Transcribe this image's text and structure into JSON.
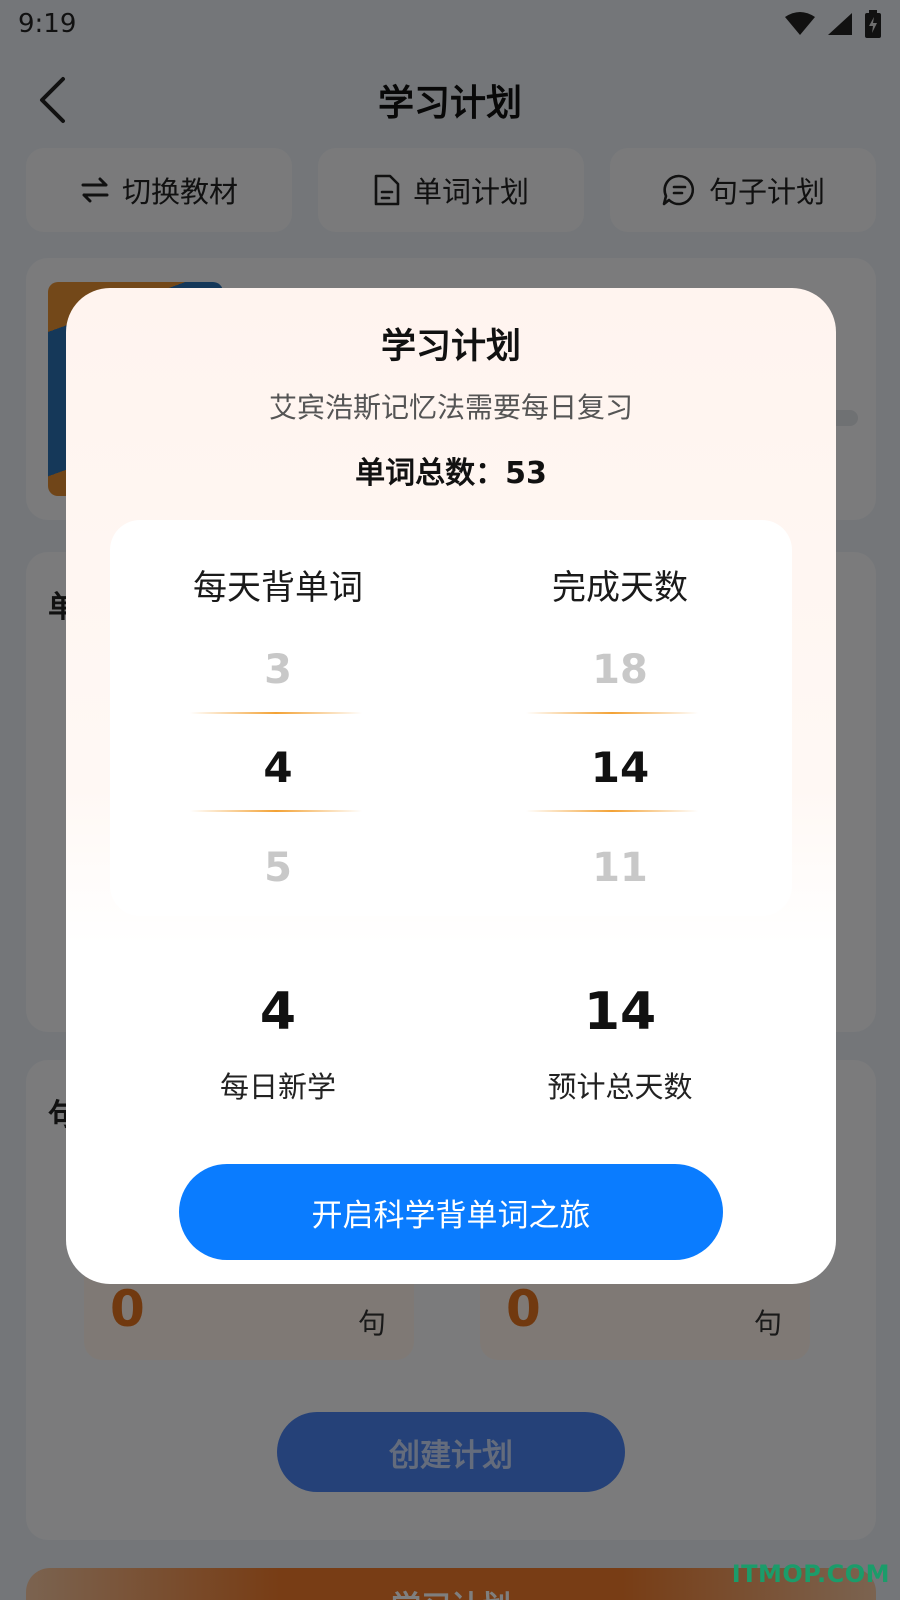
{
  "status_bar": {
    "time": "9:19"
  },
  "header": {
    "title": "学习计划"
  },
  "tabs": [
    {
      "label": "切换教材",
      "icon": "swap-icon"
    },
    {
      "label": "单词计划",
      "icon": "document-icon"
    },
    {
      "label": "句子计划",
      "icon": "chat-icon"
    }
  ],
  "background": {
    "word_section_label": "单",
    "sentence_section_label": "句",
    "sentence_stats": [
      {
        "value": "0",
        "unit": "句"
      },
      {
        "value": "0",
        "unit": "句"
      }
    ],
    "create_button": "创建计划",
    "bottom_card_title": "学习计划"
  },
  "modal": {
    "title": "学习计划",
    "subtitle": "艾宾浩斯记忆法需要每日复习",
    "total_words": "单词总数：53",
    "picker": {
      "daily_words": {
        "header": "每天背单词",
        "prev": "3",
        "selected": "4",
        "next": "5"
      },
      "days": {
        "header": "完成天数",
        "prev": "18",
        "selected": "14",
        "next": "11"
      }
    },
    "summary": {
      "daily_new": {
        "value": "4",
        "label": "每日新学"
      },
      "total_days": {
        "value": "14",
        "label": "预计总天数"
      }
    },
    "start_button": "开启科学背单词之旅"
  },
  "watermark": "ITMOP.COM",
  "colors": {
    "primary_blue": "#0a7cff",
    "accent_orange": "#e3731f",
    "picker_highlight": "#f3a235"
  }
}
